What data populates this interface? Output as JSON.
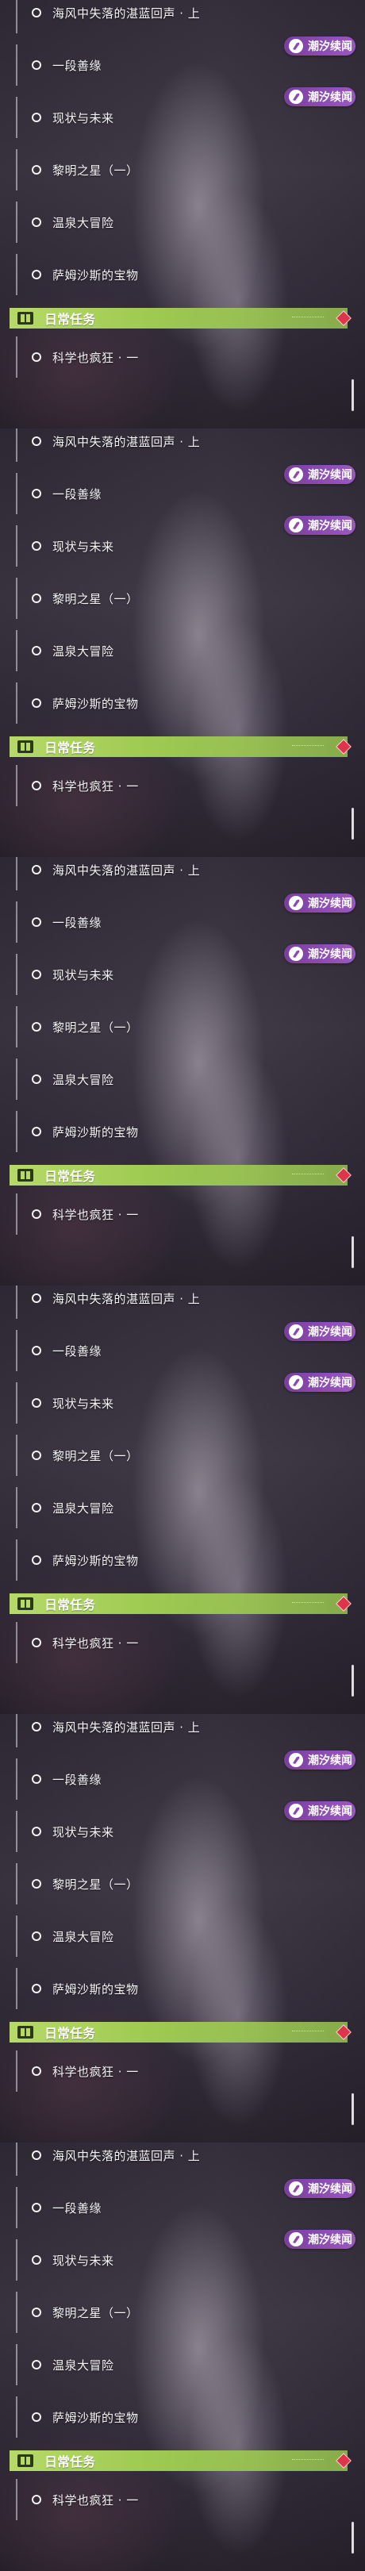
{
  "quests": [
    {
      "label": "海风中失落的湛蓝回声 · 上",
      "badge": ""
    },
    {
      "label": "一段善缘",
      "badge": "潮汐续闻"
    },
    {
      "label": "现状与未来",
      "badge": "潮汐续闻"
    },
    {
      "label": "黎明之星（一）",
      "badge": ""
    },
    {
      "label": "温泉大冒险",
      "badge": ""
    },
    {
      "label": "萨姆沙斯的宝物",
      "badge": ""
    }
  ],
  "daily_section": {
    "title": "日常任务",
    "items": [
      {
        "label": "科学也疯狂 · 一"
      }
    ]
  },
  "colors": {
    "badge": "#8a4bb0",
    "daily_bar": "#a9d05a",
    "alert": "#e0344a"
  },
  "icons": {
    "quest_marker": "circle-icon",
    "badge": "tide-story-icon",
    "daily": "book-icon",
    "alert": "alert-diamond-icon"
  }
}
